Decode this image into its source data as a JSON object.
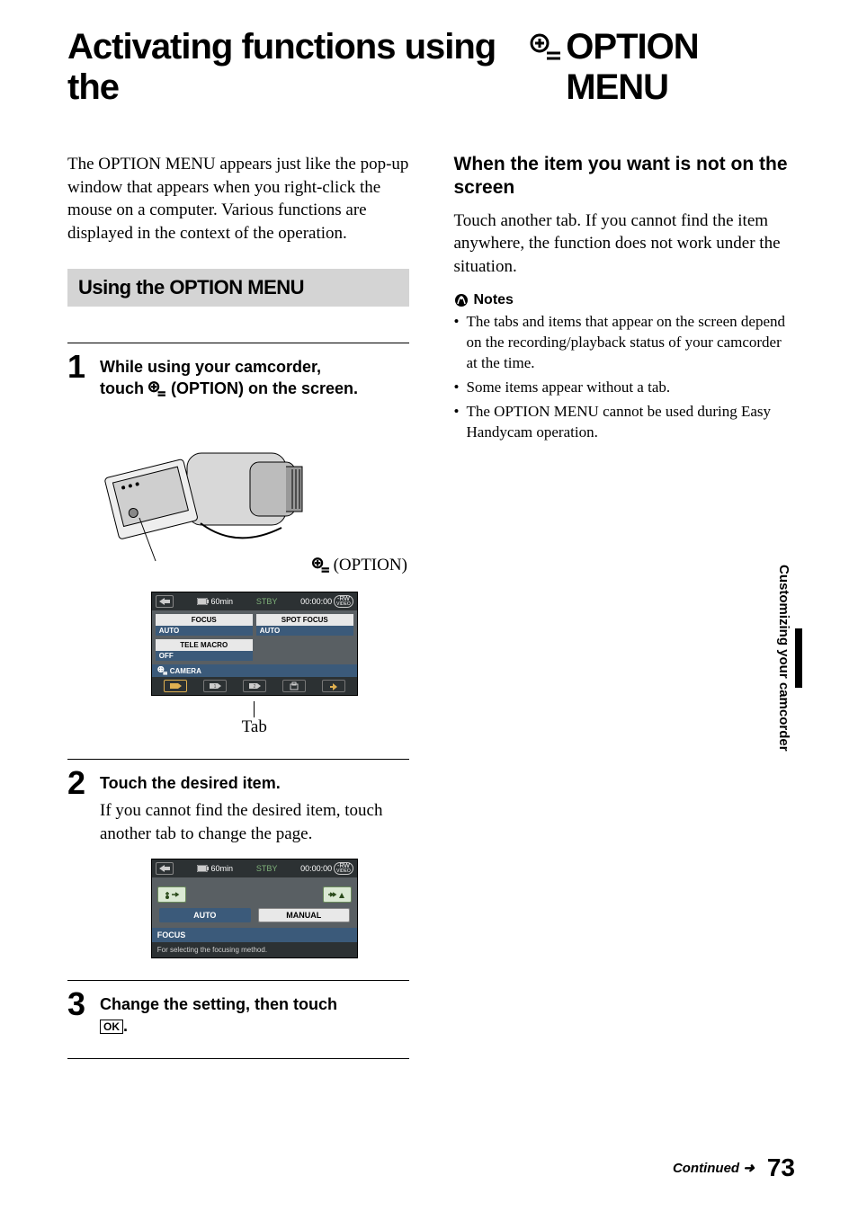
{
  "title": {
    "part1": "Activating functions using the ",
    "part2": "OPTION MENU"
  },
  "intro": "The OPTION MENU appears just like the pop-up window that appears when you right-click the mouse on a computer. Various functions are displayed in the context of the operation.",
  "section_bar": "Using the OPTION MENU",
  "steps": {
    "s1": {
      "num": "1",
      "line1": "While using your camcorder,",
      "line2a": "touch ",
      "line2b": "(OPTION) on the screen."
    },
    "s2": {
      "num": "2",
      "heading": "Touch the desired item.",
      "text": "If you cannot find the desired item, touch another tab to change the page."
    },
    "s3": {
      "num": "3",
      "heading_a": "Change the setting, then touch",
      "ok": "OK",
      "heading_b": "."
    }
  },
  "option_caption": "(OPTION)",
  "tab_caption": "Tab",
  "lcd1": {
    "battery": "60min",
    "status": "STBY",
    "time": "00:00:00",
    "disc": "-RW",
    "disc_sub": "VIDEO",
    "focus": "FOCUS",
    "focus_val": "AUTO",
    "spot": "SPOT FOCUS",
    "spot_val": "AUTO",
    "tele": "TELE MACRO",
    "tele_val": "OFF",
    "camera_row": "CAMERA"
  },
  "lcd2": {
    "battery": "60min",
    "status": "STBY",
    "time": "00:00:00",
    "disc": "-RW",
    "disc_sub": "VIDEO",
    "auto": "AUTO",
    "manual": "MANUAL",
    "focus": "FOCUS",
    "hint": "For selecting the focusing method."
  },
  "right": {
    "subheading": "When the item you want is not on the screen",
    "para": "Touch another tab. If you cannot find the item anywhere, the function does not work under the situation.",
    "notes_label": "Notes",
    "bullets": [
      "The tabs and items that appear on the screen depend on the recording/playback status of your camcorder at the time.",
      "Some items appear without a tab.",
      "The OPTION MENU cannot be used during Easy Handycam operation."
    ]
  },
  "side_tab": "Customizing your camcorder",
  "footer": {
    "continued": "Continued",
    "page": "73"
  }
}
